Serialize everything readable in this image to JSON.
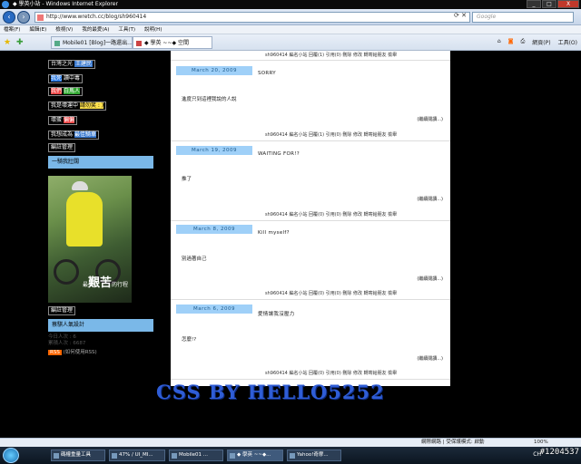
{
  "window": {
    "title": "◆ 學英小站 - Windows Internet Explorer",
    "tray_label": "專區",
    "tray_label2": "空間",
    "buttons": [
      "_",
      "□",
      "X"
    ]
  },
  "address": {
    "url": "http://www.wretch.cc/blog/sh960414",
    "search_placeholder": "Google"
  },
  "menu": [
    "檔案(F)",
    "編輯(E)",
    "檢視(V)",
    "我的最愛(A)",
    "工具(T)",
    "說明(H)"
  ],
  "tabs": [
    {
      "label": "Mobile01 [Blog]一路還出..."
    },
    {
      "label": "◆ 學英 ~~◆ 空間"
    }
  ],
  "toolbar_right": [
    "網頁(P)",
    "工具(O)"
  ],
  "sidebar": {
    "tags": [
      {
        "label": "台灣之光",
        "extra": "王建民"
      },
      {
        "label": "我死",
        "extra": "讀中毒"
      },
      {
        "label": "我們",
        "extra": "白馬人"
      },
      {
        "label": "我是壞運中",
        "extra": "請勿笑 : )"
      },
      {
        "label": "壞蛋",
        "extra": "偏偏"
      },
      {
        "label": "我想成為",
        "extra": "最佳騎車"
      },
      {
        "label": "編註管理",
        "extra": ""
      }
    ],
    "section1": "一騎我壯闊",
    "photo_caption_big": "艱苦",
    "photo_caption_pre": "最",
    "photo_caption_post": "的行程",
    "manage": "編註管理",
    "section2": "蔡騏人氣設計",
    "stats": [
      "今日人次 : 6",
      "累積人次 : 6687"
    ],
    "rss": "RSS",
    "rss_help": "(如何使用RSS)"
  },
  "posts": [
    {
      "date": "",
      "title": "",
      "body": "",
      "meta": "sh960414  編名小站      回覆(1) 引用(0) 刪除 修改 轉寄給朋友 檢舉"
    },
    {
      "date": "March 20, 2009",
      "title": "SORRY",
      "body": "進度只到這裡我說的人說",
      "readmore": "(繼續閱讀...)",
      "meta": "sh960414  編名小站      回覆(1) 引用(0) 刪除 修改 轉寄給朋友 檢舉"
    },
    {
      "date": "March 19, 2009",
      "title": "WAITING FOR!?",
      "body": "推了",
      "readmore": "(繼續閱讀...)",
      "meta": "sh960414  編名小站      回覆(0) 引用(0) 刪除 修改 轉寄給朋友 檢舉"
    },
    {
      "date": "March 8, 2009",
      "title": "Kill myself?",
      "body": "別過著自己",
      "readmore": "(繼續閱讀...)",
      "meta": "sh960414  編名小站      回覆(0) 引用(0) 刪除 修改 轉寄給朋友 檢舉"
    },
    {
      "date": "March 6, 2009",
      "title": "愛情讓我沒壓力",
      "body": "怎麼!?",
      "readmore": "(繼續閱讀...)",
      "meta": "sh960414  編名小站      回覆(0) 引用(0) 刪除 修改 轉寄給朋友 檢舉"
    }
  ],
  "watermark": "CSS BY HELLO5252",
  "status": {
    "zone": "網際網路 | 受保護模式: 啟動",
    "zoom": "100%"
  },
  "taskbar": {
    "items": [
      "碼權重量工具",
      "47% / UI_MI...",
      "Mobile01 ...",
      "◆ 學英 ~~◆...",
      "Yahoo!奇摩..."
    ],
    "tray": "CH"
  },
  "corner_id": "#1204537"
}
